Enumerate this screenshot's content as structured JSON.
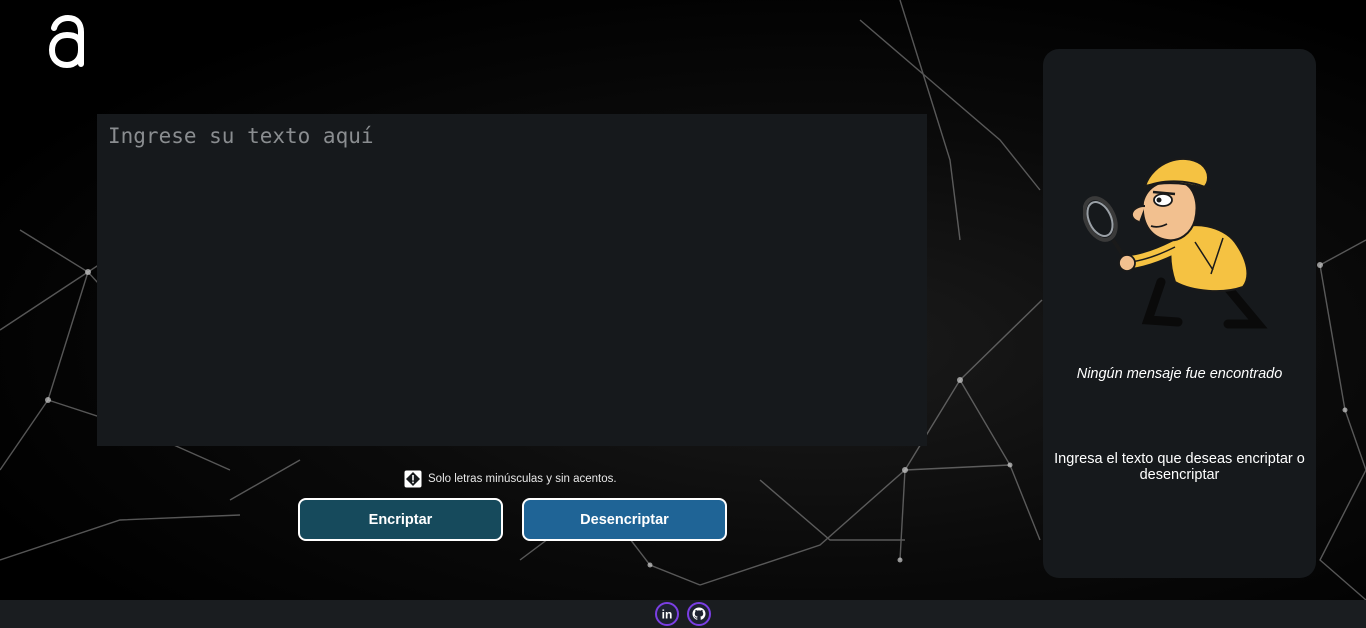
{
  "logo": {
    "icon": "alura-logo-icon"
  },
  "editor": {
    "placeholder": "Ingrese su texto aquí",
    "value": ""
  },
  "hint": {
    "icon": "warning-icon",
    "text": "Solo letras minúsculas y sin acentos."
  },
  "actions": {
    "encrypt_label": "Encriptar",
    "decrypt_label": "Desencriptar"
  },
  "result_panel": {
    "illustration": "detective-icon",
    "title": "Ningún mensaje fue encontrado",
    "subtitle": "Ingresa el texto que deseas encriptar o desencriptar"
  },
  "footer": {
    "links": [
      "linkedin-icon",
      "github-icon"
    ]
  },
  "colors": {
    "background": "#000000",
    "surface": "#16191c",
    "encrypt_button": "#164a5c",
    "decrypt_button": "#1f6496",
    "text": "#ffffff",
    "social_ring": "#7b3fe4"
  }
}
